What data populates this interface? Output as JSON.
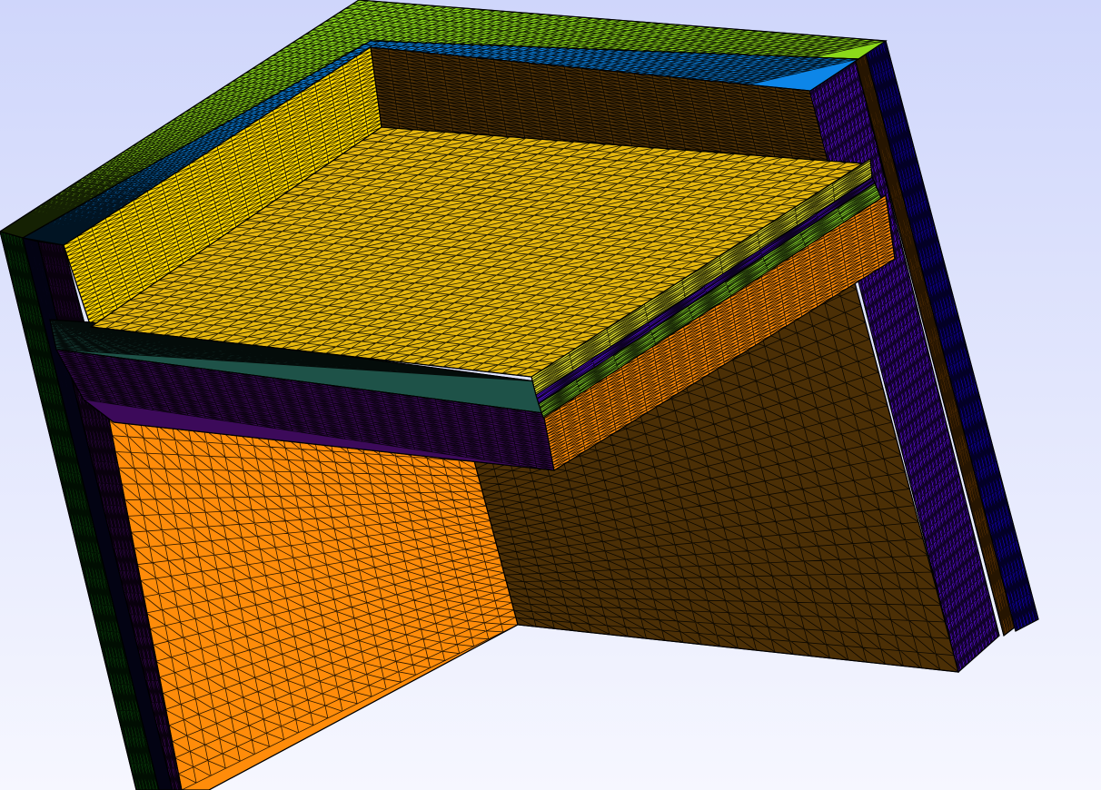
{
  "viewport": {
    "background_top": "#cfd6fb",
    "background_bottom": "#f6f7ff",
    "mesh_line_color": "#000000"
  },
  "materials": {
    "floor_top": "#e5b70f",
    "floor_slab_front": "#3c0a5a",
    "floor_slab_dark": "#1e5248",
    "floor_stripe_yellow": "#f0ef2e",
    "floor_stripe_green": "#8cde2a",
    "floor_stripe_violet": "#5a10e8",
    "floor_underside_orange": "#ff8c0a",
    "wall_left_inner": "#ff8c0a",
    "wall_left_back": "#ffd700",
    "wall_left_outer_green": "#0d6010",
    "wall_left_outer_navy": "#1a1480",
    "wall_left_outer_purple": "#3c0a5a",
    "wall_top_green": "#8cd91a",
    "wall_top_blue": "#0d86e8",
    "wall_back_upper": "#4b2f06",
    "wall_back_lower": "#4b2f06",
    "wall_right_violet": "#6a10ff",
    "wall_right_orange": "#ff8c0a",
    "wall_right_blue": "#1a00ff"
  }
}
